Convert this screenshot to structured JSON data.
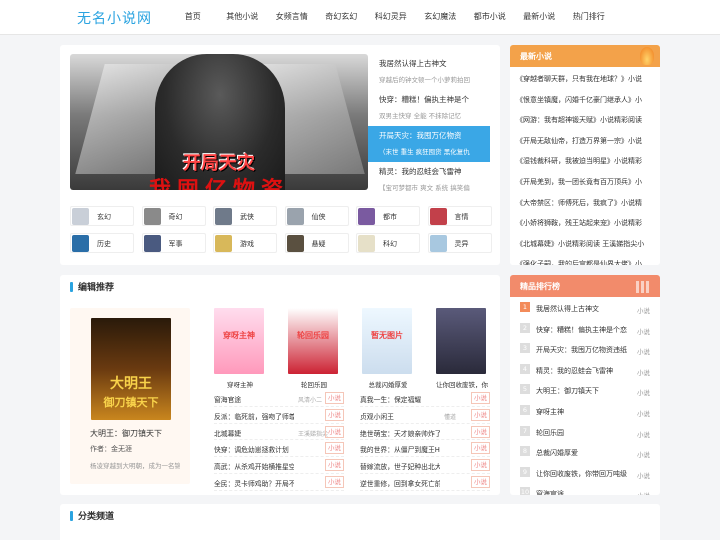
{
  "site": {
    "logo": "无名小说网"
  },
  "nav": [
    "首页",
    "其他小说",
    "女频言情",
    "奇幻玄幻",
    "科幻灵异",
    "玄幻魔法",
    "都市小说",
    "最新小说",
    "热门排行"
  ],
  "banner": {
    "title_line1": "开局天灾",
    "title_line2": "我囤亿物资"
  },
  "slides": [
    {
      "title": "我居然认得上古神文",
      "desc": "穿越后的钟文顿一个小萝莉拍回"
    },
    {
      "title": "快穿：糟糕！偏执主神是个",
      "desc": "双男主快穿 全能 不抹除记忆"
    },
    {
      "title": "开局天灾：我囤万亿物资",
      "desc": "（末世 重生 疯狂囤货 黑化复仇"
    },
    {
      "title": "精灵：我的忍蛙会飞雷神",
      "desc": "【宝可梦都市 爽文 系统 搞笑偏"
    }
  ],
  "categories": [
    {
      "label": "玄幻",
      "color": "#c9cfd8"
    },
    {
      "label": "奇幻",
      "color": "#8a8a8a"
    },
    {
      "label": "武侠",
      "color": "#6f7a8a"
    },
    {
      "label": "仙侠",
      "color": "#9aa3ad"
    },
    {
      "label": "都市",
      "color": "#7a5aa0"
    },
    {
      "label": "言情",
      "color": "#c2404a"
    },
    {
      "label": "历史",
      "color": "#2a6ea8"
    },
    {
      "label": "军事",
      "color": "#4a5a80"
    },
    {
      "label": "游戏",
      "color": "#d8b85a"
    },
    {
      "label": "悬疑",
      "color": "#5a5040"
    },
    {
      "label": "科幻",
      "color": "#e6e0c8"
    },
    {
      "label": "灵异",
      "color": "#a8c8e0"
    }
  ],
  "latest": {
    "title": "最新小说",
    "items": [
      "《穿越者聊天群，只有我在地球？》小说",
      "《恨意坐镇魔，闪婚千亿豪门继承人》小",
      "《网游：我有超神锻天赋》小说精彩阅读",
      "《开局无敌仙帝，打造万界第一宗》小说",
      "《湿钱裁科研，我被迫当明星》小说精彩",
      "《开局羌到，我一团长竟有百万顶兵》小",
      "《大帝禁区：师傅死后，我疯了》小说精",
      "《小娇将狮鞍，残王站起来宠》小说精彩",
      "《北城幕婕》小说精彩阅读 王溪娣指尖小",
      "《强化子嗣，我的后宫都是仙界大佬》小"
    ]
  },
  "editor": {
    "title": "编辑推荐"
  },
  "featured": {
    "name": "大明王：御刀镇天下",
    "author": "作者：金无涯",
    "desc": "杨凌穿越到大明朝，成为一名锦衣卫，开局金手指",
    "cover_line1": "大明王",
    "cover_line2": "御刀镇天下"
  },
  "books": [
    {
      "name": "穿呀主神",
      "c1": "#fde",
      "c2": "#f9b",
      "tx": "穿呀主神"
    },
    {
      "name": "轮回乐园",
      "c1": "#fff",
      "c2": "#c23",
      "tx": "轮回乐园"
    },
    {
      "name": "总裁闪婚厚爱",
      "c1": "#eef8ff",
      "c2": "#cde",
      "tx": "暂无图片"
    },
    {
      "name": "让你回收废铁，你",
      "c1": "#5a5a7a",
      "c2": "#2a2a3a",
      "tx": ""
    }
  ],
  "list_left": [
    {
      "title": "窗海官途",
      "author": "风清小二",
      "tag": "小说"
    },
    {
      "title": "反派：临死前，强吻了师尊",
      "author": "",
      "tag": "小说"
    },
    {
      "title": "北城幕婕",
      "author": "王溪娣指尖",
      "tag": "小说"
    },
    {
      "title": "快穿：调危幼崽拯救计划",
      "author": "",
      "tag": "小说"
    },
    {
      "title": "高武：从杀鸡开始横推星空",
      "author": "",
      "tag": "小说"
    },
    {
      "title": "全民：灵卡师鸡助？开局不良",
      "author": "",
      "tag": "小说"
    }
  ],
  "list_right": [
    {
      "title": "真我一生：保定福耀",
      "author": "",
      "tag": "小说"
    },
    {
      "title": "贞观小闲王",
      "author": "懂道",
      "tag": "小说"
    },
    {
      "title": "绝世萌宝：天才娘亲帅炸了",
      "author": "",
      "tag": "小说"
    },
    {
      "title": "我的世界：从僵尸到魔王HIM",
      "author": "",
      "tag": "小说"
    },
    {
      "title": "替嫁流放，世子妃种出北大仓",
      "author": "",
      "tag": "小说"
    },
    {
      "title": "逆世重修，回到拿女死亡前",
      "author": "",
      "tag": "小说"
    }
  ],
  "ranking": {
    "title": "精品排行榜",
    "items": [
      "我居然认得上古神文",
      "快穿：糟糕！偏执主神是个恋",
      "开局天灾：我囤万亿物资违纸",
      "精灵：我的忍蛙会飞雷神",
      "大明王：御刀镇天下",
      "穿呀主神",
      "轮回乐园",
      "总裁闪婚厚爱",
      "让你回收废铁，你带回万吨级",
      "窗海官途"
    ],
    "tag": "小说"
  },
  "channels": {
    "title": "分类频道"
  },
  "colors": {
    "accent": "#2aa3e0",
    "orange": "#f3a24a",
    "tag_red": "#e88"
  }
}
